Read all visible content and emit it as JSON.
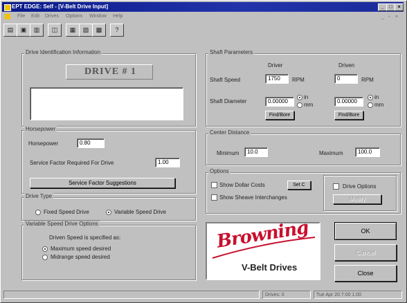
{
  "window": {
    "title": "EPT EDGE: Self - [V-Belt Drive Input]"
  },
  "menu": [
    "File",
    "Edit",
    "Drives",
    "Options",
    "Window",
    "Help"
  ],
  "toolbar_icons": [
    "open-icon",
    "save-icon",
    "print-icon",
    "preview-icon",
    "chart-icon",
    "graph-icon",
    "calculator-icon"
  ],
  "drive_id": {
    "label": "Drive Identification Information",
    "name": "DRIVE # 1",
    "notes": ""
  },
  "horsepower": {
    "label": "Horsepower",
    "hp_label": "Horsepower",
    "hp_value": "0.80",
    "sf_label": "Service Factor Required For Drive",
    "sf_value": "1.00",
    "sf_button": "Service Factor Suggestions"
  },
  "drive_type": {
    "label": "Drive Type",
    "fixed": "Fixed Speed Drive",
    "variable": "Variable Speed Drive",
    "selected": "variable"
  },
  "variable_options": {
    "label": "Variable Speed Drive Options",
    "prompt": "Driven Speed is specified as:",
    "opt1": "Maximum speed desired",
    "opt2": "Midrange speed desired",
    "selected": "opt1"
  },
  "shaft": {
    "label": "Shaft Parameters",
    "driver": "Driver",
    "driven": "Driven",
    "speed_label": "Shaft Speed",
    "driver_speed": "1750",
    "driven_speed": "0",
    "rpm": "RPM",
    "diameter_label": "Shaft Diameter",
    "driver_dia": "0.00000",
    "driven_dia": "0.00000",
    "in": "in",
    "mm": "mm",
    "find_bore": "Find/Bore"
  },
  "center": {
    "label": "Center Distance",
    "min_label": "Minimum",
    "min_value": "10.0",
    "max_label": "Maximum",
    "max_value": "100.0"
  },
  "options": {
    "label": "Options",
    "show_dollar": "Show Dollar Costs",
    "set_button": "Set C",
    "show_sheave": "Show Sheave Interchanges",
    "drive_options": "Drive Options",
    "modify": "Modify"
  },
  "logo": {
    "brand": "Browning",
    "sub": "V-Belt Drives"
  },
  "actions": {
    "ok": "OK",
    "cancel": "Cancel",
    "close": "Close"
  },
  "status": {
    "drives": "Drives: 0",
    "datetime": "Tue Apr 20 7:00 1:00"
  },
  "colors": {
    "title": "#0a1a8a",
    "brand_red": "#c8102e"
  }
}
